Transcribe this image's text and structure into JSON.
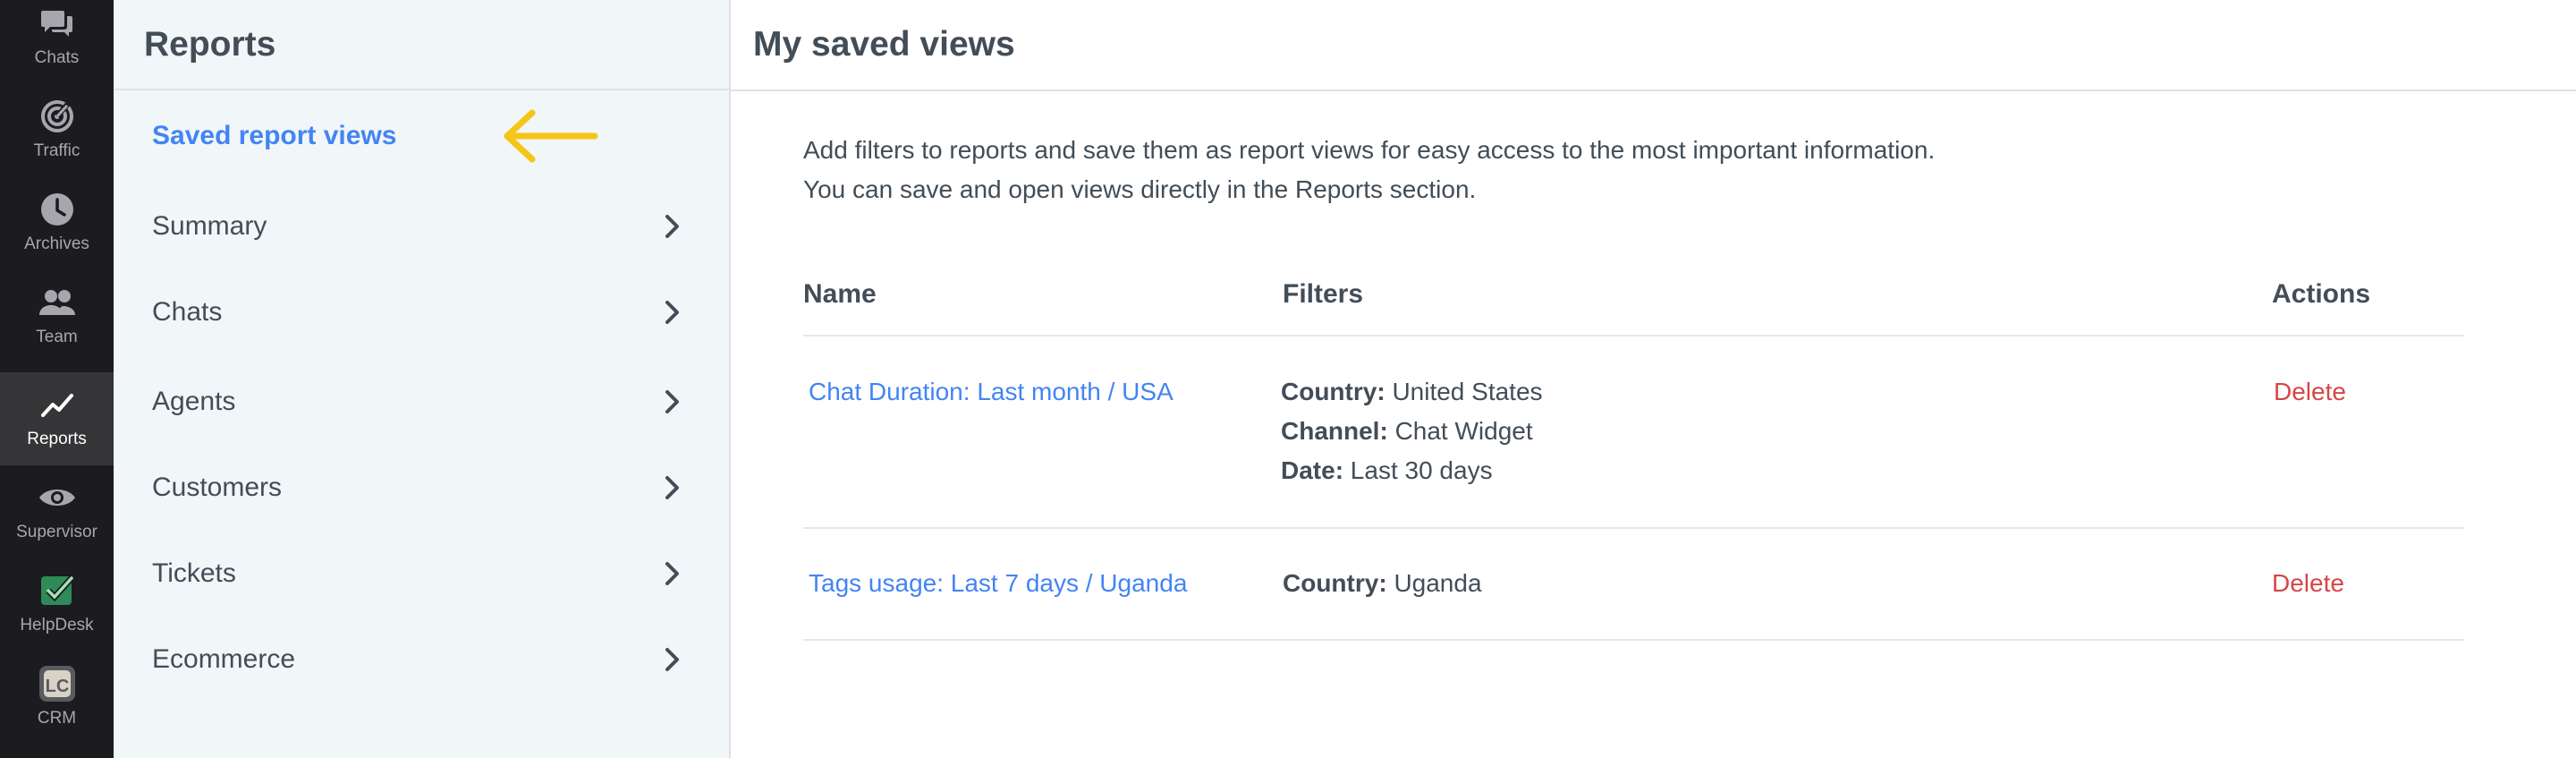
{
  "rail": {
    "items": [
      {
        "label": "Chats",
        "icon": "chat-bubbles-icon"
      },
      {
        "label": "Traffic",
        "icon": "traffic-radar-icon"
      },
      {
        "label": "Archives",
        "icon": "clock-icon"
      },
      {
        "label": "Team",
        "icon": "team-people-icon"
      },
      {
        "label": "Reports",
        "icon": "line-chart-icon"
      },
      {
        "label": "Supervisor",
        "icon": "eye-icon"
      },
      {
        "label": "HelpDesk",
        "icon": "helpdesk-check-icon"
      },
      {
        "label": "CRM",
        "icon": "crm-lc-icon"
      }
    ],
    "active": "Reports"
  },
  "subnav": {
    "title": "Reports",
    "items": [
      {
        "label": "Saved report views"
      },
      {
        "label": "Summary"
      },
      {
        "label": "Chats"
      },
      {
        "label": "Agents"
      },
      {
        "label": "Customers"
      },
      {
        "label": "Tickets"
      },
      {
        "label": "Ecommerce"
      }
    ],
    "active": "Saved report views",
    "annotation_color": "#f5c518"
  },
  "main": {
    "title": "My saved views",
    "intro_line1": "Add filters to reports and save them as report views for easy access to the most important information.",
    "intro_line2": "You can save and open views directly in the Reports section.",
    "table": {
      "headers": {
        "name": "Name",
        "filters": "Filters",
        "actions": "Actions"
      },
      "rows": [
        {
          "name": "Chat Duration: Last month / USA",
          "filters": [
            {
              "key": "Country:",
              "value": "United States"
            },
            {
              "key": "Channel:",
              "value": "Chat Widget"
            },
            {
              "key": "Date:",
              "value": "Last 30 days"
            }
          ],
          "action": "Delete"
        },
        {
          "name": "Tags usage: Last 7 days / Uganda",
          "filters": [
            {
              "key": "Country:",
              "value": "Uganda"
            }
          ],
          "action": "Delete"
        }
      ]
    }
  },
  "colors": {
    "rail_bg": "#1b1b20",
    "rail_active_bg": "#353538",
    "subnav_bg": "#f1f6f8",
    "link": "#4384f5",
    "delete": "#d64646",
    "text": "#424d57"
  }
}
